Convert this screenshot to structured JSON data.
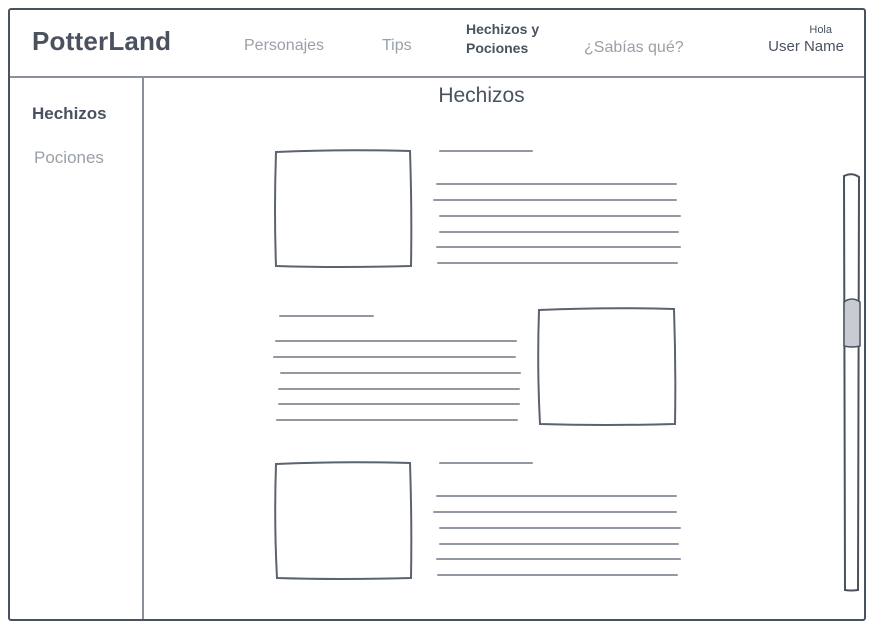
{
  "header": {
    "logo": "PotterLand",
    "nav": [
      {
        "label": "Personajes"
      },
      {
        "label": "Tips"
      },
      {
        "label_line1": "Hechizos y",
        "label_line2": "Pociones"
      },
      {
        "label": "¿Sabías qué?"
      }
    ],
    "greeting": "Hola",
    "user_name": "User Name"
  },
  "sidebar": {
    "items": [
      {
        "label": "Hechizos"
      },
      {
        "label": "Pociones"
      }
    ]
  },
  "main": {
    "title": "Hechizos",
    "cards": [
      {
        "image": "image-placeholder",
        "text": "text-placeholder-lines"
      },
      {
        "image": "image-placeholder",
        "text": "text-placeholder-lines"
      },
      {
        "image": "image-placeholder",
        "text": "text-placeholder-lines"
      }
    ]
  },
  "colors": {
    "ink": "#4a5260",
    "muted": "#9aa0a8",
    "scroll_thumb": "#c8ccd2"
  }
}
